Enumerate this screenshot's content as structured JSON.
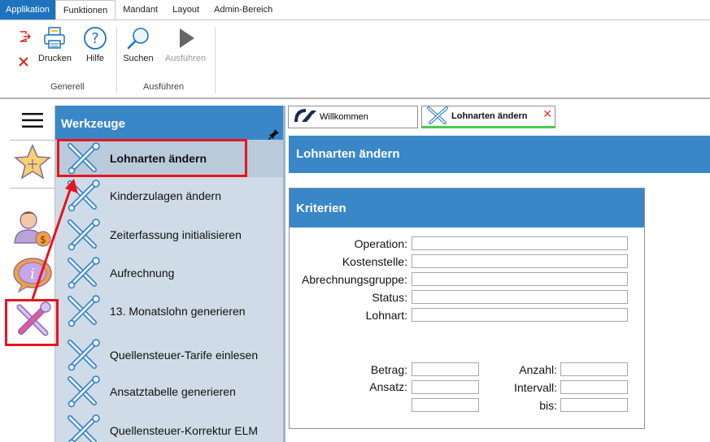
{
  "ribbon": {
    "tabs": [
      {
        "label": "Applikation"
      },
      {
        "label": "Funktionen"
      },
      {
        "label": "Mandant"
      },
      {
        "label": "Layout"
      },
      {
        "label": "Admin-Bereich"
      }
    ],
    "buttons": {
      "drucken": "Drucken",
      "hilfe": "Hilfe",
      "suchen": "Suchen",
      "ausfuehren": "Ausführen"
    },
    "groups": {
      "generell": "Generell",
      "ausfuehren": "Ausführen"
    }
  },
  "tools_panel": {
    "title": "Werkzeuge",
    "items": [
      {
        "label": "Lohnarten ändern"
      },
      {
        "label": "Kinderzulagen ändern"
      },
      {
        "label": "Zeiterfassung initialisieren"
      },
      {
        "label": "Aufrechnung"
      },
      {
        "label": "13. Monatslohn generieren"
      },
      {
        "label": "Quellensteuer-Tarife einlesen"
      },
      {
        "label": "Ansatztabelle generieren"
      },
      {
        "label": "Quellensteuer-Korrektur ELM"
      }
    ]
  },
  "doc_tabs": {
    "welcome": "Willkommen",
    "active": "Lohnarten ändern"
  },
  "main": {
    "title": "Lohnarten ändern",
    "criteria": {
      "title": "Kriterien",
      "fields": {
        "operation": {
          "label": "Operation:",
          "value": ""
        },
        "kostenstelle": {
          "label": "Kostenstelle:",
          "value": ""
        },
        "abrechnungsgruppe": {
          "label": "Abrechnungsgruppe:",
          "value": ""
        },
        "status": {
          "label": "Status:",
          "value": ""
        },
        "lohnart": {
          "label": "Lohnart:",
          "value": ""
        },
        "betrag": {
          "label": "Betrag:",
          "value": ""
        },
        "ansatz": {
          "label": "Ansatz:",
          "value": ""
        },
        "anzahl": {
          "label": "Anzahl:",
          "value": ""
        },
        "intervall": {
          "label": "Intervall:",
          "value": ""
        },
        "bis": {
          "label": "bis:",
          "value": ""
        }
      }
    }
  },
  "colors": {
    "accent_blue": "#3a87c8",
    "app_tab_blue": "#1e73be",
    "panel_bg": "#cfdbe7",
    "annotation_red": "#e8141e",
    "active_tab_green": "#4ccb4c"
  },
  "icons": {
    "strip": [
      "hamburger-menu-icon",
      "star-favorites-icon",
      "person-money-icon",
      "info-speech-bubble-icon",
      "tools-wrench-screwdriver-icon"
    ],
    "ribbon": [
      "exit-icon",
      "close-x-icon",
      "printer-icon",
      "help-question-icon",
      "magnifier-search-icon",
      "play-run-icon"
    ]
  }
}
